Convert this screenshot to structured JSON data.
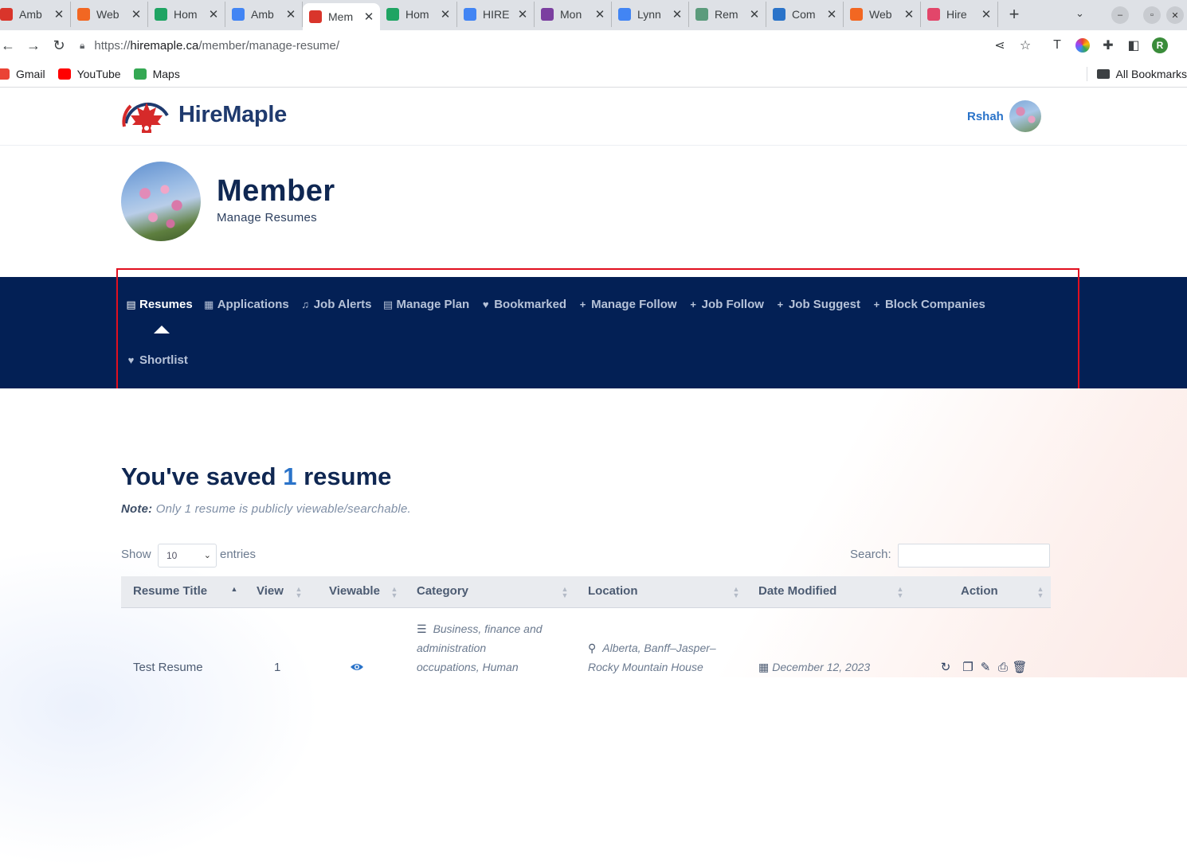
{
  "browser": {
    "tabs": [
      {
        "label": "Amb",
        "color": "#d9352b"
      },
      {
        "label": "Web",
        "color": "#f26722"
      },
      {
        "label": "Hom",
        "color": "#1fa463"
      },
      {
        "label": "Amb",
        "color": "#4285f4"
      },
      {
        "label": "Mem",
        "color": "#d9352b",
        "active": true
      },
      {
        "label": "Hom",
        "color": "#1fa463"
      },
      {
        "label": "HIRE",
        "color": "#4285f4"
      },
      {
        "label": "Mon",
        "color": "#7b3fa0"
      },
      {
        "label": "Lynn",
        "color": "#4285f4"
      },
      {
        "label": "Rem",
        "color": "#5b9b7c"
      },
      {
        "label": "Com",
        "color": "#2a73c9"
      },
      {
        "label": "Web",
        "color": "#f26722"
      },
      {
        "label": "Hire",
        "color": "#e2466a"
      }
    ],
    "url_host": "hiremaple.ca",
    "url_scheme": "https://",
    "url_path": "/member/manage-resume/",
    "bookmarks": [
      {
        "label": "Gmail",
        "color": "#ea4335"
      },
      {
        "label": "YouTube",
        "color": "#ff0000"
      },
      {
        "label": "Maps",
        "color": "#34a853"
      }
    ],
    "all_bookmarks": "All Bookmarks",
    "profile_initial": "R"
  },
  "site": {
    "logo_text": "HireMaple",
    "user_name": "Rshah"
  },
  "hero": {
    "title": "Member",
    "subtitle": "Manage Resumes"
  },
  "nav": {
    "items": [
      {
        "label": "Resumes",
        "icon": "document-icon",
        "glyph": "▤"
      },
      {
        "label": "Applications",
        "icon": "list-icon",
        "glyph": "▦"
      },
      {
        "label": "Job Alerts",
        "icon": "bell-icon",
        "glyph": "♫"
      },
      {
        "label": "Manage Plan",
        "icon": "document-icon",
        "glyph": "▤"
      },
      {
        "label": "Bookmarked",
        "icon": "heart-icon",
        "glyph": "♥"
      },
      {
        "label": "Manage Follow",
        "icon": "plus-icon",
        "glyph": "+"
      },
      {
        "label": "Job Follow",
        "icon": "plus-icon",
        "glyph": "+"
      },
      {
        "label": "Job Suggest",
        "icon": "plus-icon",
        "glyph": "+"
      },
      {
        "label": "Block Companies",
        "icon": "plus-icon",
        "glyph": "+"
      }
    ],
    "second_row": {
      "label": "Shortlist",
      "icon": "heart-icon",
      "glyph": "♥"
    }
  },
  "main": {
    "saved_prefix": "You've saved ",
    "saved_count": "1",
    "saved_suffix": " resume",
    "note_label": "Note:",
    "note_text": " Only 1 resume is publicly viewable/searchable.",
    "show_label": "Show",
    "entries_value": "10",
    "entries_label": "entries",
    "search_label": "Search:",
    "columns": [
      "Resume Title",
      "View",
      "Viewable",
      "Category",
      "Location",
      "Date Modified",
      "Action"
    ],
    "row": {
      "title": "Test Resume",
      "view": "1",
      "category_lines": [
        "Business, finance and",
        "administration",
        "occupations, Human"
      ],
      "location_lines": [
        "Alberta, Banff–Jasper–",
        "Rocky Mountain House"
      ],
      "date": "December 12, 2023"
    }
  }
}
